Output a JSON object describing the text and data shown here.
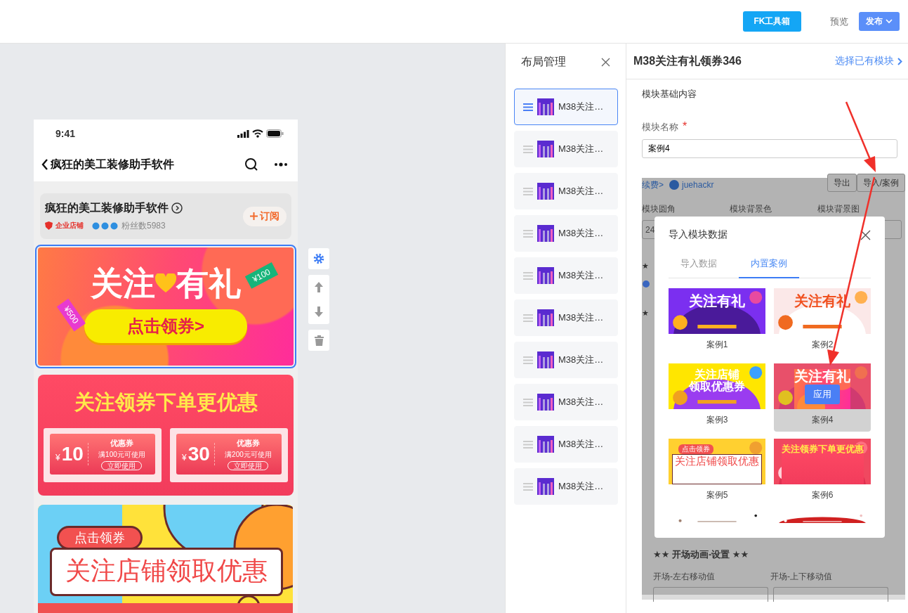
{
  "topbar": {
    "toolbox_button": "FK工具箱",
    "preview_link": "预览",
    "publish_button": "发布"
  },
  "phone": {
    "time": "9:41",
    "nav_title": "疯狂的美工装修助手软件",
    "shop": {
      "name": "疯狂的美工装修助手软件",
      "badge": "企业店铺",
      "fans": "粉丝数5983",
      "subscribe_button": "订阅"
    },
    "banners": [
      {
        "kind": "gift",
        "selected": true,
        "title_left": "关注",
        "title_right": "有礼",
        "tag_left": "¥500",
        "tag_right": "¥100",
        "button": "点击领券>"
      },
      {
        "kind": "coupons",
        "selected": false,
        "title": "关注领券下单更优惠",
        "coupons": [
          {
            "currency": "¥",
            "amount": "10",
            "name": "优惠券",
            "rule": "满100元可使用",
            "action": "立即使用"
          },
          {
            "currency": "¥",
            "amount": "30",
            "name": "优惠券",
            "rule": "满200元可使用",
            "action": "立即使用"
          }
        ]
      },
      {
        "kind": "store",
        "selected": false,
        "tag": "点击领券",
        "title": "关注店铺领取优惠"
      }
    ]
  },
  "layout_panel": {
    "title": "布局管理",
    "items": [
      {
        "label": "M38关注…",
        "selected": true
      },
      {
        "label": "M38关注…",
        "selected": false
      },
      {
        "label": "M38关注…",
        "selected": false
      },
      {
        "label": "M38关注…",
        "selected": false
      },
      {
        "label": "M38关注…",
        "selected": false
      },
      {
        "label": "M38关注…",
        "selected": false
      },
      {
        "label": "M38关注…",
        "selected": false
      },
      {
        "label": "M38关注…",
        "selected": false
      },
      {
        "label": "M38关注…",
        "selected": false
      },
      {
        "label": "M38关注…",
        "selected": false
      }
    ]
  },
  "editor": {
    "title": "M38关注有礼领券346",
    "choose_link": "选择已有模块",
    "section": "模块基础内容",
    "name_label": "模块名称",
    "required_mark": "*",
    "name_value": "案例4",
    "embedded": {
      "renew_link": "续费>",
      "user": "juehackr",
      "export_button": "导出",
      "import_button": "导入/案例",
      "labels": [
        "模块圆角",
        "模块背景色",
        "模块背景图"
      ],
      "radius_value": "24",
      "star_marks": [
        "★",
        "★"
      ],
      "anim_title": "★★ 开场动画-设置 ★★",
      "anim_labels": [
        "开场-左右移动值",
        "开场-上下移动值"
      ]
    }
  },
  "modal": {
    "title": "导入模块数据",
    "tabs": [
      {
        "label": "导入数据",
        "selected": false
      },
      {
        "label": "内置案例",
        "selected": true
      }
    ],
    "cases": [
      {
        "kind": "arc",
        "title": "关注有礼",
        "caption": "案例1",
        "hovered": false
      },
      {
        "kind": "ticket",
        "title": "关注有礼",
        "caption": "案例2",
        "hovered": false
      },
      {
        "kind": "comic",
        "title_lines": [
          "关注店铺",
          "领取优惠券"
        ],
        "caption": "案例3",
        "hovered": false
      },
      {
        "kind": "gift",
        "title": "关注有礼",
        "caption": "案例4",
        "hovered": true,
        "apply_button": "应用"
      },
      {
        "kind": "store",
        "tag": "点击领券",
        "title": "关注店铺领取优惠",
        "caption": "案例5",
        "hovered": false
      },
      {
        "kind": "coupons",
        "title": "关注领券下单更优惠",
        "caption": "案例6",
        "hovered": false
      },
      {
        "kind": "cut-a"
      },
      {
        "kind": "cut-b"
      }
    ]
  }
}
